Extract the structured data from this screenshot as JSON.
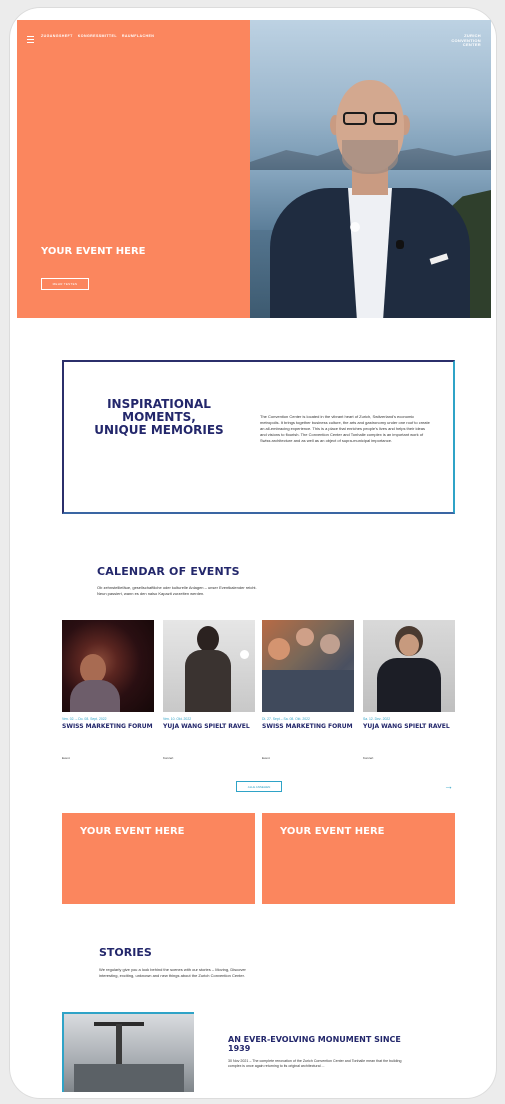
{
  "nav": {
    "items": [
      "ZUGANGSHEFT",
      "KONGRESSMITTEL",
      "RAUMFLACHEN"
    ],
    "logo": [
      "ZURICH",
      "CONVENTION",
      "CENTER"
    ]
  },
  "hero": {
    "title": "YOUR EVENT HERE",
    "button_label": "MEHR TESTEN"
  },
  "intro": {
    "title": "INSPIRATIONAL MOMENTS, UNIQUE MEMORIES",
    "text": "The Convention Center is located in the vibrant heart of Zurich, Switzerland's economic metropolis. It brings together business culture, the arts and gastronomy under one roof to create an all-embracing experience. This is a place that enriches people's lives and helps their ideas and visions to flourish. The Convention Center and Tonhalle complex is an important work of Swiss architecture and as well as an object of supra-municipal importance."
  },
  "calendar": {
    "title": "CALENDAR OF EVENTS",
    "subtitle": "Ob zehnstelliefäue, gesellschaftliche oder kulturelle Anlagen – unser Eventkalender reicht. Neun passiert, wann es den nalso Kapazit zurzeiten werden.",
    "events": [
      {
        "date": "Ven. 02. – Do. 08. Sept. 2022",
        "title": "SWISS MARKETING FORUM",
        "category": "Event"
      },
      {
        "date": "Ven. 10. Okt. 2022",
        "title": "YUJA WANG SPIELT RAVEL",
        "category": "Konzert"
      },
      {
        "date": "Di. 27. Sept – Sa. 08. Okt. 2022",
        "title": "SWISS MARKETING FORUM",
        "category": "Event"
      },
      {
        "date": "Sa. 12. Dez. 2022",
        "title": "YUJA WANG SPIELT RAVEL",
        "category": "Konzert"
      }
    ],
    "more_label": "ALLE ANSEHEN",
    "arrow": "→"
  },
  "promos": [
    {
      "title": "YOUR EVENT HERE"
    },
    {
      "title": "YOUR EVENT HERE"
    }
  ],
  "stories": {
    "title": "STORIES",
    "subtitle": "We regularly give you a look behind the scenes with our stories – Moving, Discover interesting, exciting, unknown and new things about the Zurich Convention Center.",
    "feature_title": "AN EVER-EVOLVING MONUMENT SINCE 1939",
    "feature_text": "30 Nov 2021 – The complete renovation of the Zurich Convention Center and Tonhalle mean that the building complex is once again returning to its original architectural ..."
  },
  "colors": {
    "accent": "#fb865e",
    "navy": "#23276b",
    "teal": "#2fa3c7"
  }
}
